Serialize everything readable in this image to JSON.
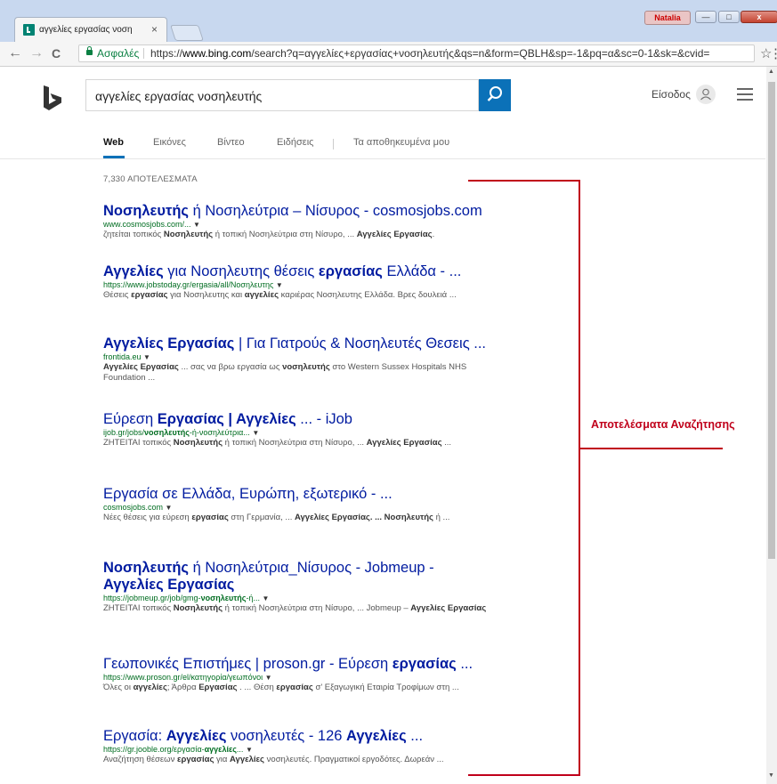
{
  "browser": {
    "tab_title": "αγγελίες εργασίας νοση",
    "tab_close": "×",
    "profile_name": "Natalia",
    "secure_label": "Ασφαλές",
    "url_scheme": "https://",
    "url_host": "www.bing.com",
    "url_path": "/search?q=αγγελίες+εργασίας+νοσηλευτής&qs=n&form=QBLH&sp=-1&pq=α&sc=0-1&sk=&cvid=",
    "back": "←",
    "forward": "→",
    "reload": "C",
    "star": "☆",
    "menu": "⋮",
    "minimize": "—",
    "maximize": "□",
    "close": "x"
  },
  "header": {
    "query": "αγγελίες εργασίας νοσηλευτής",
    "signin_label": "Είσοδος"
  },
  "tabs": [
    {
      "label": "Web",
      "active": true
    },
    {
      "label": "Εικόνες"
    },
    {
      "label": "Βίντεο"
    },
    {
      "label": "Ειδήσεις"
    },
    {
      "label": "Τα αποθηκευμένα μου"
    }
  ],
  "results_count": "7,330 ΑΠΟΤΕΛΕΣΜΑΤΑ",
  "results": [
    {
      "title": [
        {
          "t": "Νοσηλευτής",
          "b": true
        },
        {
          "t": " ή Νοσηλεύτρια – Νίσυρος - cosmosjobs.com"
        }
      ],
      "url": [
        {
          "t": "www.cosmosjobs.com/..."
        }
      ],
      "snippet": [
        {
          "t": "ζητείται τοπικός "
        },
        {
          "t": "Νοσηλευτής",
          "b": true
        },
        {
          "t": " ή τοπική Νοσηλεύτρια στη Νίσυρο, ... "
        },
        {
          "t": "Αγγελίες Εργασίας",
          "b": true
        },
        {
          "t": "."
        }
      ]
    },
    {
      "title": [
        {
          "t": "Αγγελίες",
          "b": true
        },
        {
          "t": " για Νοσηλευτης θέσεις "
        },
        {
          "t": "εργασίας",
          "b": true
        },
        {
          "t": " Ελλάδα - ..."
        }
      ],
      "url": [
        {
          "t": "https://www.jobstoday.gr/ergasia/all/Νοσηλευτης"
        }
      ],
      "snippet": [
        {
          "t": "Θέσεις "
        },
        {
          "t": "εργασίας",
          "b": true
        },
        {
          "t": " για Νοσηλευτης και "
        },
        {
          "t": "αγγελίες",
          "b": true
        },
        {
          "t": " καριέρας Νοσηλευτης Ελλάδα. Βρες δουλειά ..."
        }
      ]
    },
    {
      "title": [
        {
          "t": "Αγγελίες Εργασίας",
          "b": true
        },
        {
          "t": " | Για Γιατρούς & Νοσηλευτές Θεσεις ..."
        }
      ],
      "url": [
        {
          "t": "frontida.eu"
        }
      ],
      "snippet": [
        {
          "t": "Αγγελίες Εργασίας",
          "b": true
        },
        {
          "t": " ... σας να βρω εργασία ως "
        },
        {
          "t": "νοσηλευτής",
          "b": true
        },
        {
          "t": " στο Western Sussex Hospitals NHS Foundation ..."
        }
      ]
    },
    {
      "title": [
        {
          "t": "Εύρεση "
        },
        {
          "t": "Εργασίας | Αγγελίες",
          "b": true
        },
        {
          "t": " ... - iJob"
        }
      ],
      "url": [
        {
          "t": "ijob.gr/jobs/"
        },
        {
          "t": "νοσηλευτής",
          "b": true
        },
        {
          "t": "-ή-νοσηλεύτρια..."
        }
      ],
      "snippet": [
        {
          "t": "ΖΗΤΕΙΤΑΙ τοπικός "
        },
        {
          "t": "Νοσηλευτής",
          "b": true
        },
        {
          "t": " ή τοπική Νοσηλεύτρια στη Νίσυρο, ... "
        },
        {
          "t": "Αγγελίες Εργασίας",
          "b": true
        },
        {
          "t": " ..."
        }
      ]
    },
    {
      "title": [
        {
          "t": "Εργασία σε Ελλάδα, Ευρώπη, εξωτερικό - ..."
        }
      ],
      "url": [
        {
          "t": "cosmosjobs.com"
        }
      ],
      "snippet": [
        {
          "t": "Νέες θέσεις για εύρεση "
        },
        {
          "t": "εργασίας",
          "b": true
        },
        {
          "t": " στη Γερμανία, ... "
        },
        {
          "t": "Αγγελίες Εργασίας. ... Νοσηλευτής",
          "b": true
        },
        {
          "t": " ή ..."
        }
      ]
    },
    {
      "title": [
        {
          "t": "Νοσηλευτής",
          "b": true
        },
        {
          "t": " ή Νοσηλεύτρια_Νίσυρος - Jobmeup - "
        },
        {
          "t": "Αγγελίες Εργασίας",
          "b": true
        }
      ],
      "url": [
        {
          "t": "https://jobmeup.gr/job/gmg-"
        },
        {
          "t": "νοσηλευτής",
          "b": true
        },
        {
          "t": "-ή..."
        }
      ],
      "snippet": [
        {
          "t": "ΖΗΤΕΙΤΑΙ τοπικός "
        },
        {
          "t": "Νοσηλευτής",
          "b": true
        },
        {
          "t": " ή τοπική Νοσηλεύτρια στη Νίσυρο, ... Jobmeup – "
        },
        {
          "t": "Αγγελίες Εργασίας",
          "b": true
        }
      ]
    },
    {
      "title": [
        {
          "t": "Γεωπονικές Επιστήμες | proson.gr - Εύρεση "
        },
        {
          "t": "εργασίας",
          "b": true
        },
        {
          "t": " ..."
        }
      ],
      "url": [
        {
          "t": "https://www.proson.gr/el/κατηγορία/γεωπόνοι"
        }
      ],
      "snippet": [
        {
          "t": "Όλες οι "
        },
        {
          "t": "αγγελίες",
          "b": true
        },
        {
          "t": "; Άρθρα "
        },
        {
          "t": "Εργασίας",
          "b": true
        },
        {
          "t": " . ... Θέση "
        },
        {
          "t": "εργασίας",
          "b": true
        },
        {
          "t": " σ' Εξαγωγική Εταιρία Τροφίμων στη ..."
        }
      ]
    },
    {
      "title": [
        {
          "t": "Εργασία: "
        },
        {
          "t": "Αγγελίες",
          "b": true
        },
        {
          "t": " νοσηλευτές - 126 "
        },
        {
          "t": "Αγγελίες",
          "b": true
        },
        {
          "t": " ..."
        }
      ],
      "url": [
        {
          "t": "https://gr.jooble.org/εργασία-"
        },
        {
          "t": "αγγελίες",
          "b": true
        },
        {
          "t": "..."
        }
      ],
      "snippet": [
        {
          "t": "Αναζήτηση θέσεων "
        },
        {
          "t": "εργασίας",
          "b": true
        },
        {
          "t": " για "
        },
        {
          "t": "Αγγελίες",
          "b": true
        },
        {
          "t": " νοσηλευτές. Πραγματικοί εργοδότες. Δωρεάν ..."
        }
      ]
    }
  ],
  "annotation": {
    "label": "Αποτελέσματα Αναζήτησης",
    "color": "#c0001a"
  },
  "icons": {
    "bing_logo": "bing-logo-icon",
    "search": "search-icon",
    "avatar": "user-icon",
    "menu": "hamburger-icon"
  }
}
